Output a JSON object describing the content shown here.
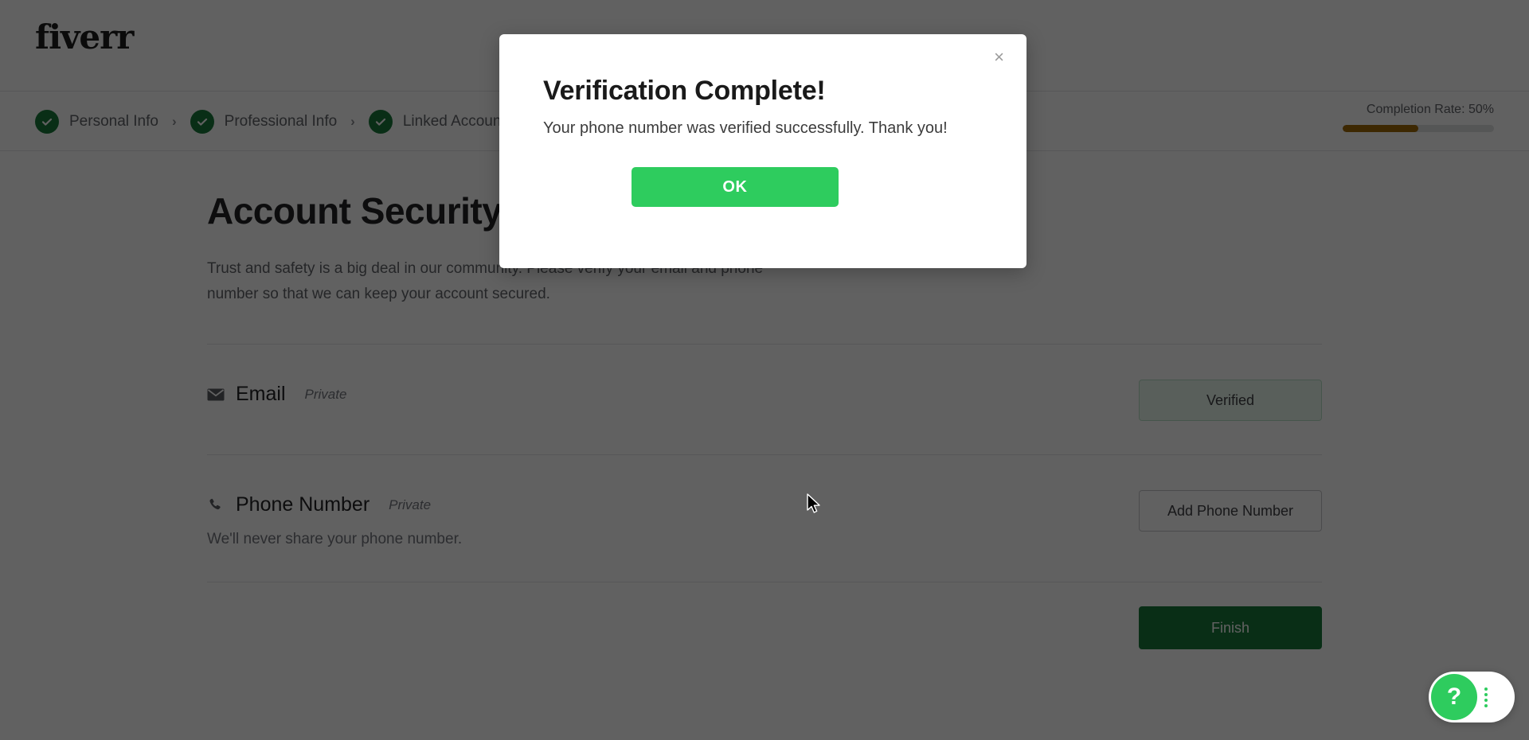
{
  "header": {
    "logo_text": "fiverr"
  },
  "steps": {
    "items": [
      {
        "label": "Personal Info",
        "status": "complete",
        "icon": "check-icon"
      },
      {
        "label": "Professional Info",
        "status": "complete",
        "icon": "check-icon"
      },
      {
        "label": "Linked Accounts",
        "status": "complete",
        "icon": "check-icon"
      }
    ],
    "separator": "›"
  },
  "completion": {
    "label": "Completion Rate: 50%",
    "percent": 50,
    "fill_color": "#a06a06",
    "track_color": "#dfe1e3"
  },
  "main": {
    "title": "Account Security",
    "description": "Trust and safety is a big deal in our community. Please verify your email and phone number so that we can keep your account secured.",
    "rows": [
      {
        "icon": "envelope-icon",
        "title": "Email",
        "privacy": "Private",
        "subtext": "",
        "action_label": "Verified",
        "action_style": "verified"
      },
      {
        "icon": "phone-icon",
        "title": "Phone Number",
        "privacy": "Private",
        "subtext": "We'll never share your phone number.",
        "action_label": "Add Phone Number",
        "action_style": "outline"
      }
    ],
    "finish_label": "Finish"
  },
  "modal": {
    "title": "Verification Complete!",
    "message": "Your phone number was verified successfully. Thank you!",
    "ok_label": "OK",
    "close_label": "×",
    "ok_color": "#2ecc5e"
  },
  "help_widget": {
    "icon_label": "?",
    "menu_icon": "vertical-dots-icon",
    "accent_color": "#2ecc5e"
  }
}
